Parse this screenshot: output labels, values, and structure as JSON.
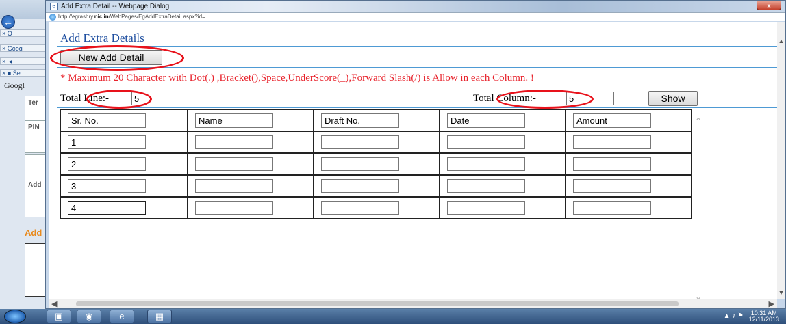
{
  "bg_browser": {
    "tabs": [
      "Q",
      "Goog",
      "",
      "Se"
    ],
    "google_label": "Googl",
    "panels": [
      "Ter",
      "PIN",
      "Add"
    ],
    "add_heading": "Add"
  },
  "dialog": {
    "title": "Add Extra Detail -- Webpage Dialog",
    "url_prefix": "http://egrashry.",
    "url_domain": "nic.in",
    "url_suffix": "/WebPages/EgAddExtraDetail.aspx?id=",
    "close_label": "x"
  },
  "page": {
    "heading": "Add Extra Details",
    "new_button_label": "New Add Detail",
    "notice": "* Maximum 20 Character with Dot(.) ,Bracket(),Space,UnderScore(_),Forward Slash(/) is Allow in each Column. !",
    "total_line_label": "Total Line:-",
    "total_line_value": "5",
    "total_column_label": "Total Column:-",
    "total_column_value": "5",
    "show_button_label": "Show"
  },
  "grid": {
    "headers": [
      "Sr. No.",
      "Name",
      "Draft No.",
      "Date",
      "Amount"
    ],
    "rows": [
      [
        "1",
        "",
        "",
        "",
        ""
      ],
      [
        "2",
        "",
        "",
        "",
        ""
      ],
      [
        "3",
        "",
        "",
        "",
        ""
      ],
      [
        "4",
        "",
        "",
        "",
        ""
      ]
    ]
  },
  "taskbar": {
    "time": "10:31 AM",
    "date": "12/11/2013"
  },
  "colors": {
    "heading": "#1f4fa0",
    "notice": "#e8242d",
    "rule": "#4e9ad4",
    "annotation": "#e8121b"
  }
}
